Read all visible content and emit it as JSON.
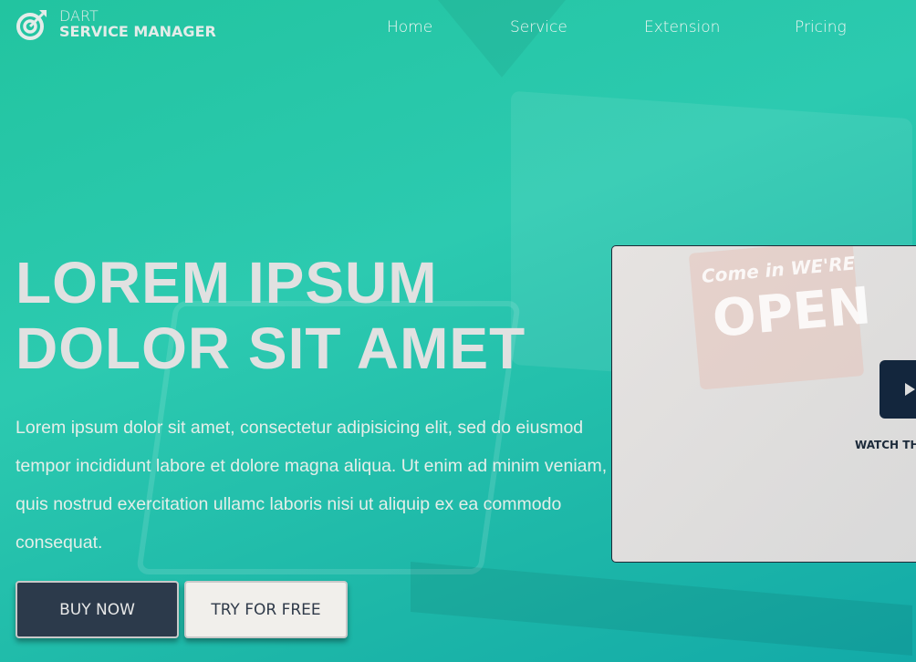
{
  "brand": {
    "line1": "DART",
    "line2": "SERVICE MANAGER",
    "icon": "target-arrow-icon"
  },
  "nav": [
    {
      "label": "Home"
    },
    {
      "label": "Service"
    },
    {
      "label": "Extension"
    },
    {
      "label": "Pricing"
    }
  ],
  "hero": {
    "title_line1": "LOREM IPSUM",
    "title_line2": "DOLOR SIT AMET",
    "description": "Lorem ipsum dolor sit amet, consectetur adipisicing elit, sed do eiusmod tempor incididunt labore et dolore magna aliqua. Ut enim ad minim veniam, quis nostrud exercitation ullamc laboris nisi ut aliquip ex ea commodo consequat.",
    "buy_label": "BUY NOW",
    "try_label": "TRY FOR FREE"
  },
  "video": {
    "watch_label": "WATCH TH",
    "sign_top": "Come in WE'RE",
    "sign_main": "OPEN",
    "play_icon": "play-icon"
  },
  "colors": {
    "accent": "#22c4a0",
    "dark_button": "#2c3a4b",
    "light_button": "#f1efeb"
  }
}
